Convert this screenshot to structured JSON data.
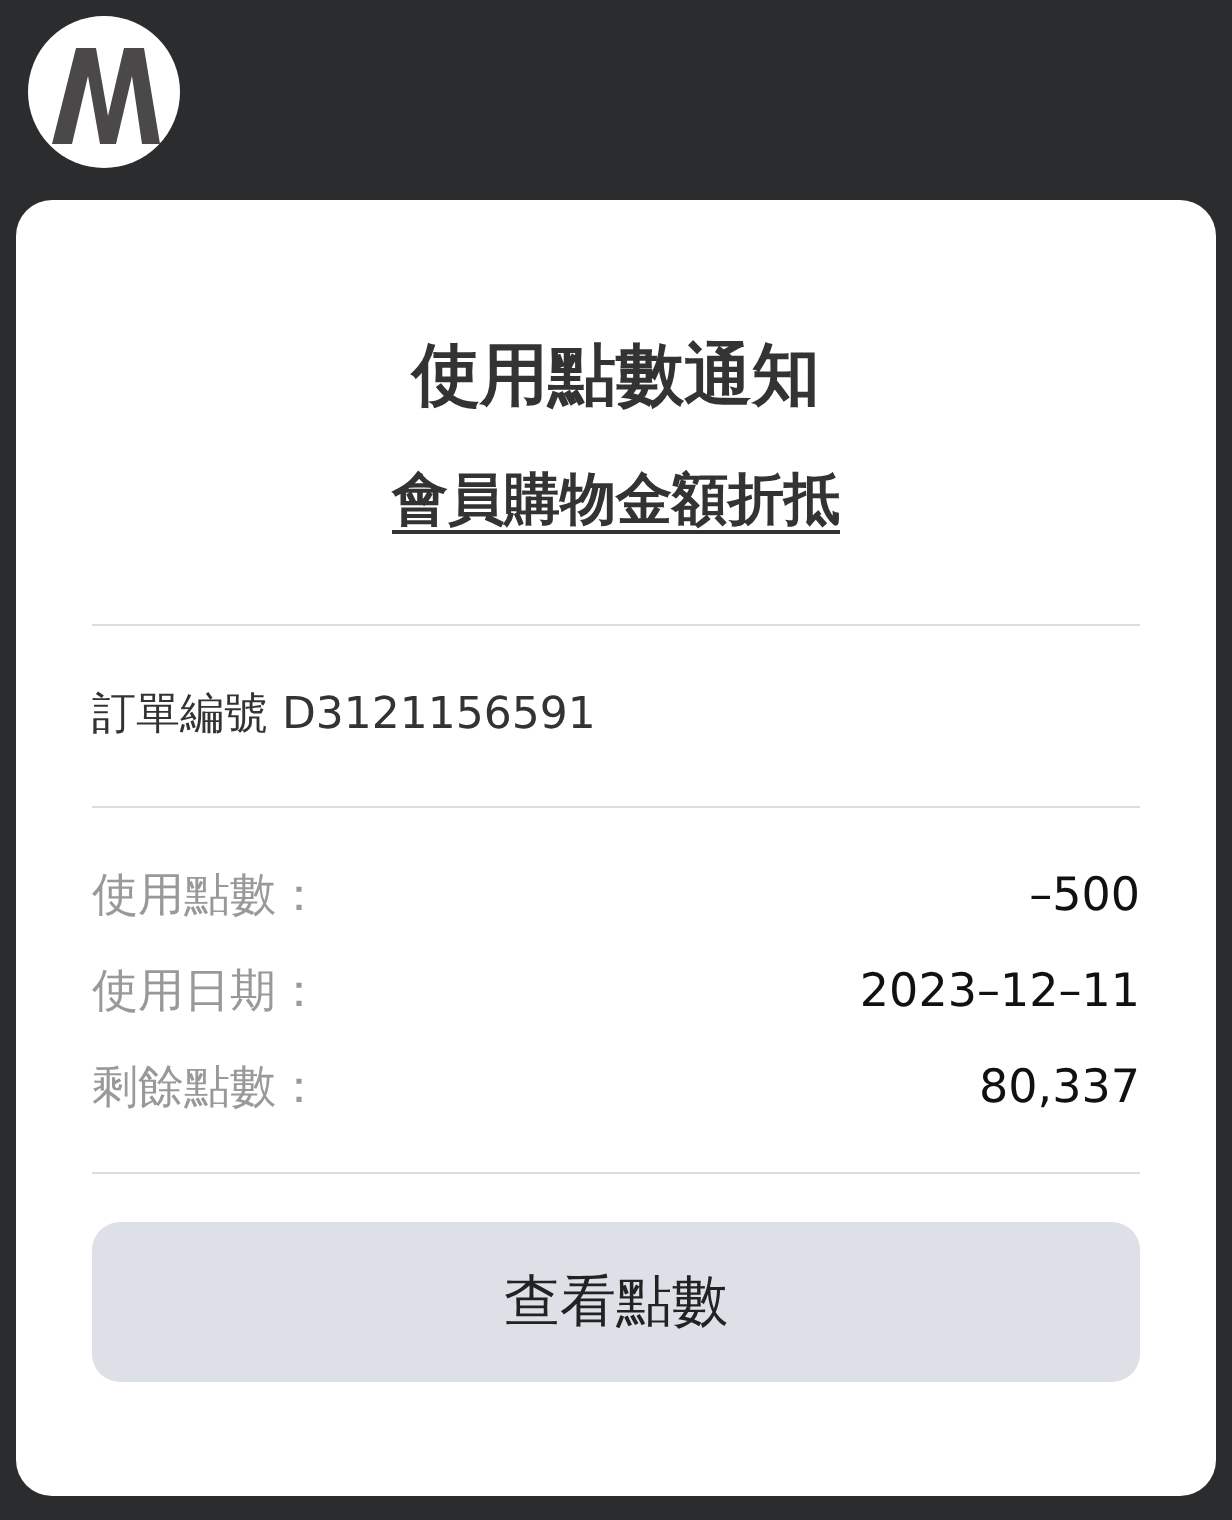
{
  "notice": {
    "title": "使用點數通知",
    "subtitle": "會員購物金額折抵",
    "order": "訂單編號 D3121156591",
    "details": [
      {
        "label": "使用點數：",
        "value": "–500"
      },
      {
        "label": "使用日期：",
        "value": "2023–12–11"
      },
      {
        "label": "剩餘點數：",
        "value": "80,337"
      }
    ],
    "button": "查看點數"
  }
}
